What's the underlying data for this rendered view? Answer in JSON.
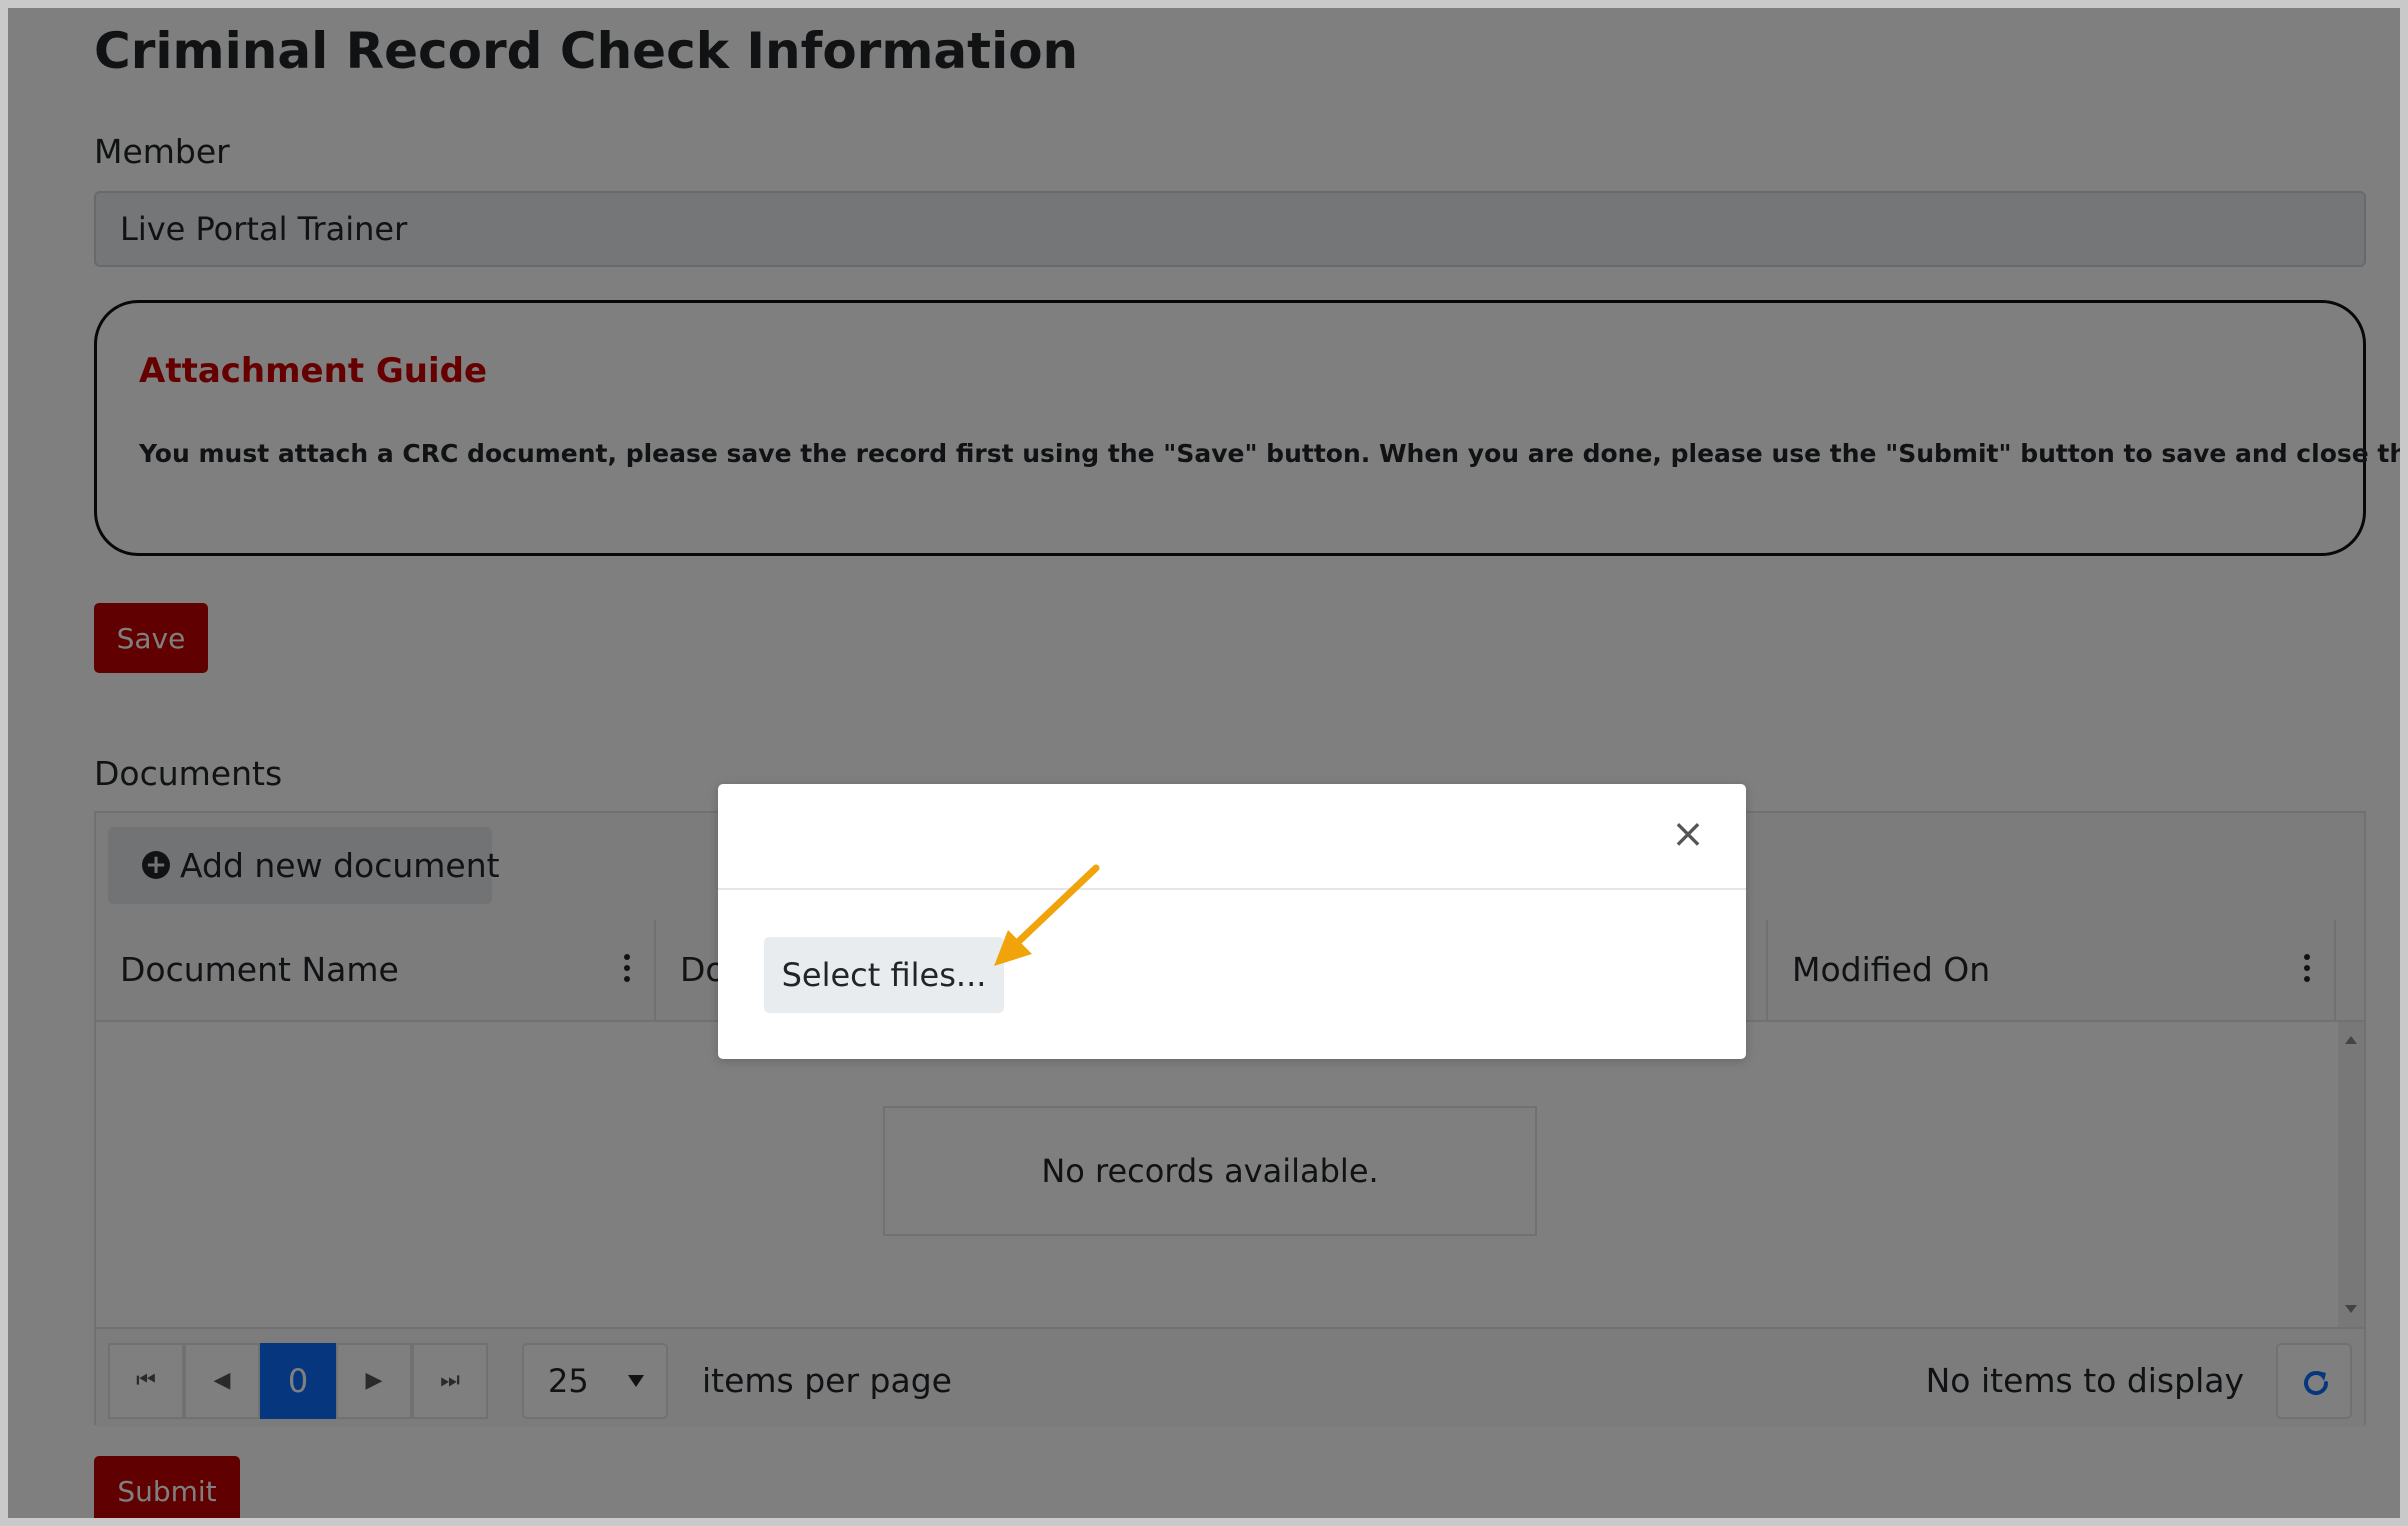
{
  "page": {
    "title": "Criminal Record Check Information"
  },
  "member": {
    "label": "Member",
    "value": "Live Portal Trainer"
  },
  "guide": {
    "title": "Attachment Guide",
    "text": "You must attach a CRC document, please save the record first using the \"Save\" button. When you are done, please use the \"Submit\" button to save and close the window."
  },
  "actions": {
    "save_label": "Save",
    "submit_label": "Submit"
  },
  "documents": {
    "label": "Documents",
    "add_label": "Add new document",
    "columns": [
      "Document Name",
      "Do",
      "Modified On"
    ],
    "empty_message": "No records available.",
    "pager": {
      "current_page": "0",
      "page_size": "25",
      "items_per_page_label": "items per page",
      "status": "No items to display"
    }
  },
  "modal": {
    "close_glyph": "×",
    "select_files_label": "Select files..."
  },
  "colors": {
    "brand_red": "#c00000",
    "guide_title": "#cc0000",
    "pager_active": "#0d6efd",
    "arrow": "#f0a30a"
  },
  "icons": [
    "plus-circle-icon",
    "kebab-menu-icon",
    "first-page-icon",
    "prev-page-icon",
    "next-page-icon",
    "last-page-icon",
    "dropdown-caret-icon",
    "refresh-icon",
    "close-icon",
    "pointer-arrow-icon"
  ]
}
